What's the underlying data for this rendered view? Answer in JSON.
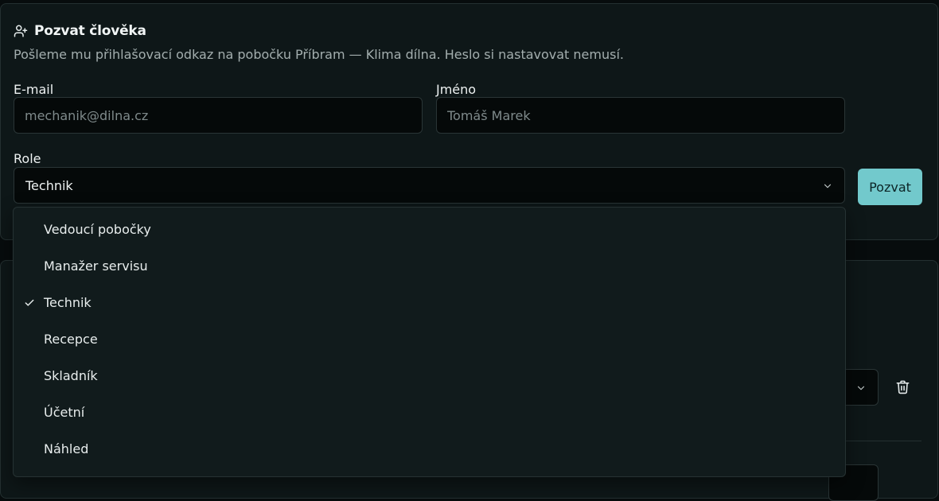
{
  "invite": {
    "title": "Pozvat člověka",
    "description": "Pošleme mu přihlašovací odkaz na pobočku Příbram — Klima dílna. Heslo si nastavovat nemusí.",
    "email": {
      "label": "E-mail",
      "placeholder": "mechanik@dilna.cz",
      "value": ""
    },
    "name": {
      "label": "Jméno",
      "placeholder": "Tomáš Marek",
      "value": ""
    },
    "role": {
      "label": "Role",
      "selected": "Technik"
    },
    "submit_label": "Pozvat"
  },
  "role_options": [
    {
      "label": "Vedoucí pobočky",
      "selected": false
    },
    {
      "label": "Manažer servisu",
      "selected": false
    },
    {
      "label": "Technik",
      "selected": true
    },
    {
      "label": "Recepce",
      "selected": false
    },
    {
      "label": "Skladník",
      "selected": false
    },
    {
      "label": "Účetní",
      "selected": false
    },
    {
      "label": "Náhled",
      "selected": false
    }
  ],
  "icons": {
    "title": "user-plus-icon",
    "select": "chevron-down-icon",
    "selected_option": "check-icon",
    "delete": "trash-icon"
  },
  "colors": {
    "accent": "#72c9cc",
    "background": "#070c0d",
    "card": "#0e1718",
    "dropdown": "#111b1c"
  }
}
